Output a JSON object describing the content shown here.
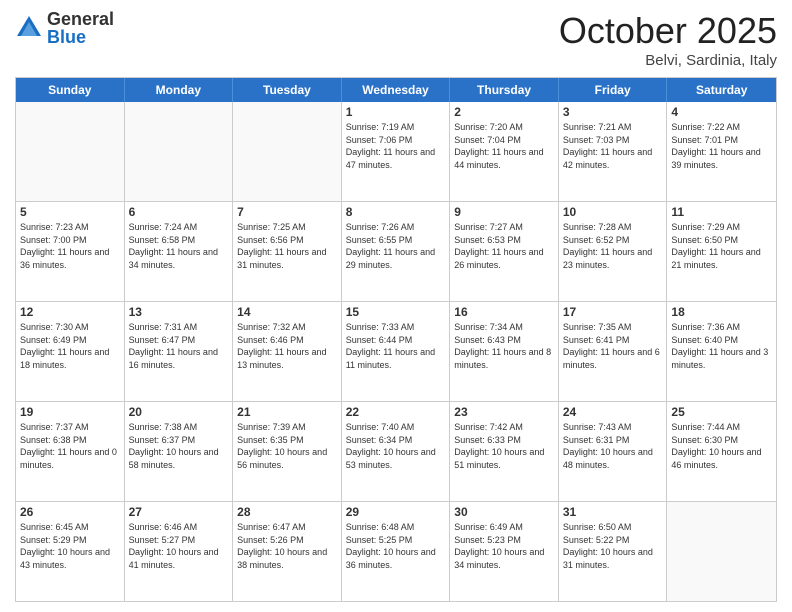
{
  "logo": {
    "general": "General",
    "blue": "Blue"
  },
  "title": "October 2025",
  "location": "Belvi, Sardinia, Italy",
  "days_of_week": [
    "Sunday",
    "Monday",
    "Tuesday",
    "Wednesday",
    "Thursday",
    "Friday",
    "Saturday"
  ],
  "weeks": [
    [
      {
        "day": "",
        "content": ""
      },
      {
        "day": "",
        "content": ""
      },
      {
        "day": "",
        "content": ""
      },
      {
        "day": "1",
        "content": "Sunrise: 7:19 AM\nSunset: 7:06 PM\nDaylight: 11 hours and 47 minutes."
      },
      {
        "day": "2",
        "content": "Sunrise: 7:20 AM\nSunset: 7:04 PM\nDaylight: 11 hours and 44 minutes."
      },
      {
        "day": "3",
        "content": "Sunrise: 7:21 AM\nSunset: 7:03 PM\nDaylight: 11 hours and 42 minutes."
      },
      {
        "day": "4",
        "content": "Sunrise: 7:22 AM\nSunset: 7:01 PM\nDaylight: 11 hours and 39 minutes."
      }
    ],
    [
      {
        "day": "5",
        "content": "Sunrise: 7:23 AM\nSunset: 7:00 PM\nDaylight: 11 hours and 36 minutes."
      },
      {
        "day": "6",
        "content": "Sunrise: 7:24 AM\nSunset: 6:58 PM\nDaylight: 11 hours and 34 minutes."
      },
      {
        "day": "7",
        "content": "Sunrise: 7:25 AM\nSunset: 6:56 PM\nDaylight: 11 hours and 31 minutes."
      },
      {
        "day": "8",
        "content": "Sunrise: 7:26 AM\nSunset: 6:55 PM\nDaylight: 11 hours and 29 minutes."
      },
      {
        "day": "9",
        "content": "Sunrise: 7:27 AM\nSunset: 6:53 PM\nDaylight: 11 hours and 26 minutes."
      },
      {
        "day": "10",
        "content": "Sunrise: 7:28 AM\nSunset: 6:52 PM\nDaylight: 11 hours and 23 minutes."
      },
      {
        "day": "11",
        "content": "Sunrise: 7:29 AM\nSunset: 6:50 PM\nDaylight: 11 hours and 21 minutes."
      }
    ],
    [
      {
        "day": "12",
        "content": "Sunrise: 7:30 AM\nSunset: 6:49 PM\nDaylight: 11 hours and 18 minutes."
      },
      {
        "day": "13",
        "content": "Sunrise: 7:31 AM\nSunset: 6:47 PM\nDaylight: 11 hours and 16 minutes."
      },
      {
        "day": "14",
        "content": "Sunrise: 7:32 AM\nSunset: 6:46 PM\nDaylight: 11 hours and 13 minutes."
      },
      {
        "day": "15",
        "content": "Sunrise: 7:33 AM\nSunset: 6:44 PM\nDaylight: 11 hours and 11 minutes."
      },
      {
        "day": "16",
        "content": "Sunrise: 7:34 AM\nSunset: 6:43 PM\nDaylight: 11 hours and 8 minutes."
      },
      {
        "day": "17",
        "content": "Sunrise: 7:35 AM\nSunset: 6:41 PM\nDaylight: 11 hours and 6 minutes."
      },
      {
        "day": "18",
        "content": "Sunrise: 7:36 AM\nSunset: 6:40 PM\nDaylight: 11 hours and 3 minutes."
      }
    ],
    [
      {
        "day": "19",
        "content": "Sunrise: 7:37 AM\nSunset: 6:38 PM\nDaylight: 11 hours and 0 minutes."
      },
      {
        "day": "20",
        "content": "Sunrise: 7:38 AM\nSunset: 6:37 PM\nDaylight: 10 hours and 58 minutes."
      },
      {
        "day": "21",
        "content": "Sunrise: 7:39 AM\nSunset: 6:35 PM\nDaylight: 10 hours and 56 minutes."
      },
      {
        "day": "22",
        "content": "Sunrise: 7:40 AM\nSunset: 6:34 PM\nDaylight: 10 hours and 53 minutes."
      },
      {
        "day": "23",
        "content": "Sunrise: 7:42 AM\nSunset: 6:33 PM\nDaylight: 10 hours and 51 minutes."
      },
      {
        "day": "24",
        "content": "Sunrise: 7:43 AM\nSunset: 6:31 PM\nDaylight: 10 hours and 48 minutes."
      },
      {
        "day": "25",
        "content": "Sunrise: 7:44 AM\nSunset: 6:30 PM\nDaylight: 10 hours and 46 minutes."
      }
    ],
    [
      {
        "day": "26",
        "content": "Sunrise: 6:45 AM\nSunset: 5:29 PM\nDaylight: 10 hours and 43 minutes."
      },
      {
        "day": "27",
        "content": "Sunrise: 6:46 AM\nSunset: 5:27 PM\nDaylight: 10 hours and 41 minutes."
      },
      {
        "day": "28",
        "content": "Sunrise: 6:47 AM\nSunset: 5:26 PM\nDaylight: 10 hours and 38 minutes."
      },
      {
        "day": "29",
        "content": "Sunrise: 6:48 AM\nSunset: 5:25 PM\nDaylight: 10 hours and 36 minutes."
      },
      {
        "day": "30",
        "content": "Sunrise: 6:49 AM\nSunset: 5:23 PM\nDaylight: 10 hours and 34 minutes."
      },
      {
        "day": "31",
        "content": "Sunrise: 6:50 AM\nSunset: 5:22 PM\nDaylight: 10 hours and 31 minutes."
      },
      {
        "day": "",
        "content": ""
      }
    ]
  ]
}
